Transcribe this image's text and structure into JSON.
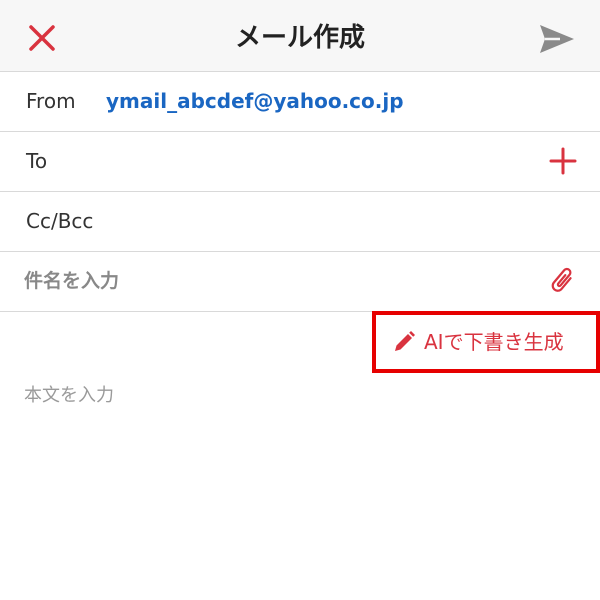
{
  "header": {
    "title": "メール作成"
  },
  "from": {
    "label": "From",
    "value": "ymail_abcdef@yahoo.co.jp"
  },
  "to": {
    "label": "To"
  },
  "cc_bcc": {
    "label": "Cc/Bcc"
  },
  "subject": {
    "placeholder": "件名を入力",
    "value": ""
  },
  "ai_draft": {
    "label": "AIで下書き生成"
  },
  "body": {
    "placeholder": "本文を入力",
    "value": ""
  },
  "icons": {
    "close": "close-icon",
    "send": "send-icon",
    "add_recipient": "plus-icon",
    "attach": "paperclip-icon",
    "ai": "pencil-icon"
  },
  "colors": {
    "accent_red": "#d9333f",
    "link_blue": "#1a66c2",
    "highlight_border": "#e60000",
    "icon_gray": "#8a8a8a"
  }
}
